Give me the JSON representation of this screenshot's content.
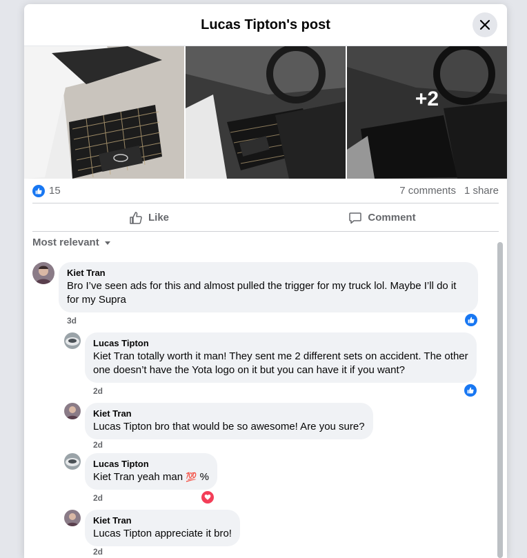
{
  "header": {
    "title": "Lucas Tipton's post",
    "close_icon": "close-icon"
  },
  "photos": {
    "more_count": "+2"
  },
  "stats": {
    "reactions": "15",
    "comments": "7 comments",
    "shares": "1 share"
  },
  "actions": {
    "like": "Like",
    "comment": "Comment"
  },
  "sort": {
    "label": "Most relevant"
  },
  "comments": [
    {
      "name": "Kiet Tran",
      "text": "Bro I’ve seen ads for this and almost pulled the trigger for my truck lol. Maybe I’ll do it for my Supra",
      "time": "3d",
      "reaction": "like"
    },
    {
      "name": "Lucas Tipton",
      "text": "Kiet Tran totally worth it man! They sent me 2 different sets on accident. The other one doesn’t have the Yota logo on it but you can have it if you want?",
      "time": "2d",
      "reaction": "like"
    },
    {
      "name": "Kiet Tran",
      "text": "Lucas Tipton bro that would be so awesome! Are you sure?",
      "time": "2d"
    },
    {
      "name": "Lucas Tipton",
      "text_prefix": "Kiet Tran yeah man ",
      "emoji": "💯",
      "text_suffix": " %",
      "time": "2d",
      "reaction": "love"
    },
    {
      "name": "Kiet Tran",
      "text": "Lucas Tipton appreciate it bro!",
      "time": "2d"
    }
  ],
  "colors": {
    "accent": "#1877f2",
    "love": "#f33e58",
    "bubble": "#f0f2f5",
    "secondary_text": "#65676b"
  }
}
